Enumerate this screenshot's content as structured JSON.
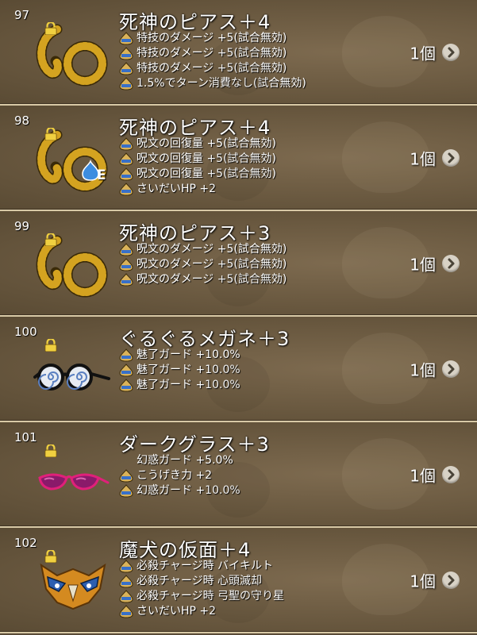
{
  "items": [
    {
      "number": "97",
      "name": "死神のピアス＋4",
      "icon": "skull-ring-earring-icon",
      "equipped": false,
      "effects": [
        {
          "text": "特技のダメージ  +5(試合無効)",
          "icon": "slime-icon"
        },
        {
          "text": "特技のダメージ  +5(試合無効)",
          "icon": "slime-icon"
        },
        {
          "text": "特技のダメージ  +5(試合無効)",
          "icon": "slime-icon"
        },
        {
          "text": "1.5%でターン消費なし(試合無効)",
          "icon": "slime-icon"
        }
      ],
      "quantity": "1個"
    },
    {
      "number": "98",
      "name": "死神のピアス＋4",
      "icon": "skull-ring-earring-icon",
      "equipped": true,
      "equipped_label": "E",
      "effects": [
        {
          "text": "呪文の回復量  +5(試合無効)",
          "icon": "slime-icon"
        },
        {
          "text": "呪文の回復量  +5(試合無効)",
          "icon": "slime-icon"
        },
        {
          "text": "呪文の回復量  +5(試合無効)",
          "icon": "slime-icon"
        },
        {
          "text": "さいだいHP  +2",
          "icon": "slime-icon"
        }
      ],
      "quantity": "1個"
    },
    {
      "number": "99",
      "name": "死神のピアス＋3",
      "icon": "skull-ring-earring-icon",
      "equipped": false,
      "effects": [
        {
          "text": "呪文のダメージ  +5(試合無効)",
          "icon": "slime-icon"
        },
        {
          "text": "呪文のダメージ  +5(試合無効)",
          "icon": "slime-icon"
        },
        {
          "text": "呪文のダメージ  +5(試合無効)",
          "icon": "slime-icon"
        }
      ],
      "quantity": "1個"
    },
    {
      "number": "100",
      "name": "ぐるぐるメガネ＋3",
      "icon": "swirl-glasses-icon",
      "equipped": false,
      "effects": [
        {
          "text": "魅了ガード  +10.0%",
          "icon": "slime-icon"
        },
        {
          "text": "魅了ガード  +10.0%",
          "icon": "slime-icon"
        },
        {
          "text": "魅了ガード  +10.0%",
          "icon": "slime-icon"
        }
      ],
      "quantity": "1個"
    },
    {
      "number": "101",
      "name": "ダークグラス＋3",
      "icon": "dark-glasses-icon",
      "equipped": false,
      "effects": [
        {
          "text": "幻惑ガード  +5.0%",
          "icon": ""
        },
        {
          "text": "こうげき力  +2",
          "icon": "slime-icon"
        },
        {
          "text": "幻惑ガード  +10.0%",
          "icon": "slime-icon"
        }
      ],
      "quantity": "1個"
    },
    {
      "number": "102",
      "name": "魔犬の仮面＋4",
      "icon": "beast-mask-icon",
      "equipped": false,
      "effects": [
        {
          "text": "必殺チャージ時  バイキルト",
          "icon": "slime-icon"
        },
        {
          "text": "必殺チャージ時  心頭滅却",
          "icon": "slime-icon"
        },
        {
          "text": "必殺チャージ時  弓聖の守り星",
          "icon": "slime-icon"
        },
        {
          "text": "さいだいHP  +2",
          "icon": "slime-icon"
        }
      ],
      "quantity": "1個"
    }
  ]
}
